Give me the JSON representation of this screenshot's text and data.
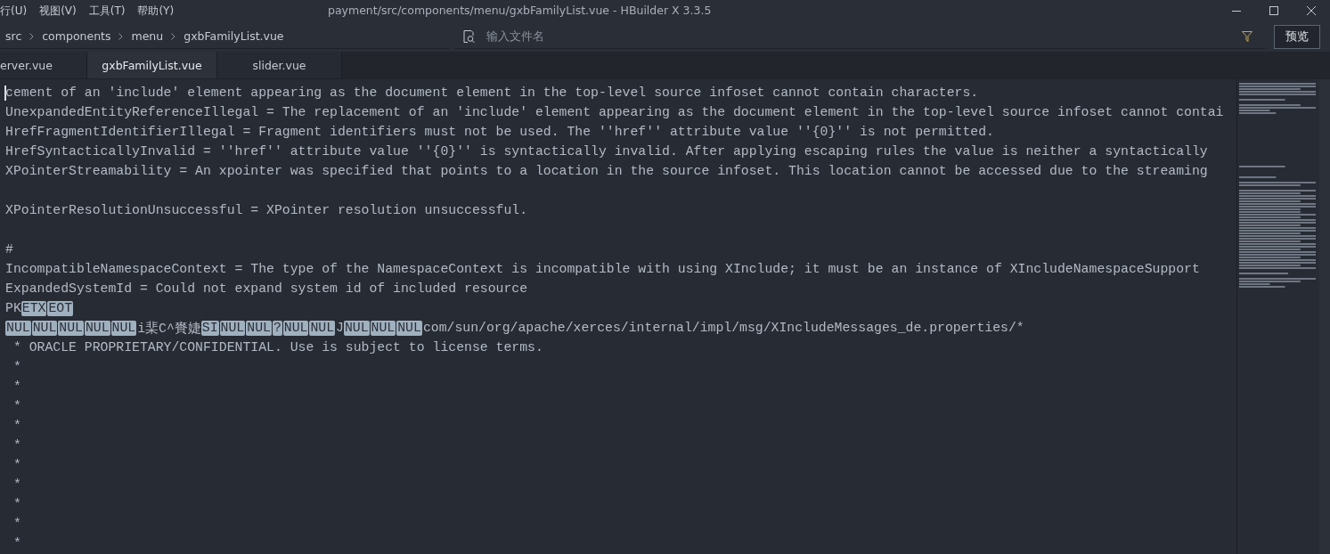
{
  "menu": [
    "行(U)",
    "视图(V)",
    "工具(T)",
    "帮助(Y)"
  ],
  "window": {
    "title": "payment/src/components/menu/gxbFamilyList.vue - HBuilder X 3.3.5"
  },
  "breadcrumb": [
    "src",
    "components",
    "menu",
    "gxbFamilyList.vue"
  ],
  "search": {
    "placeholder": "输入文件名"
  },
  "preview_button": "预览",
  "tabs": [
    {
      "label": "erver.vue",
      "selected": false
    },
    {
      "label": "gxbFamilyList.vue",
      "selected": true
    },
    {
      "label": "slider.vue",
      "selected": false
    }
  ],
  "lines": [
    {
      "kind": "code",
      "cursor": true,
      "segments": [
        {
          "kind": "text",
          "text": "cement of an 'include' element appearing as the document element in the top-level source infoset cannot contain characters."
        }
      ]
    },
    {
      "kind": "code",
      "segments": [
        {
          "kind": "text",
          "text": "UnexpandedEntityReferenceIllegal = The replacement of an 'include' element appearing as the document element in the top-level source infoset cannot contai"
        }
      ]
    },
    {
      "kind": "code",
      "segments": [
        {
          "kind": "text",
          "text": "HrefFragmentIdentifierIllegal = Fragment identifiers must not be used. The ''href'' attribute value ''{0}'' is not permitted."
        }
      ]
    },
    {
      "kind": "code",
      "segments": [
        {
          "kind": "text",
          "text": "HrefSyntacticallyInvalid = ''href'' attribute value ''{0}'' is syntactically invalid. After applying escaping rules the value is neither a syntactically"
        }
      ]
    },
    {
      "kind": "code",
      "segments": [
        {
          "kind": "text",
          "text": "XPointerStreamability = An xpointer was specified that points to a location in the source infoset. This location cannot be accessed due to the streaming"
        }
      ]
    },
    {
      "kind": "blank"
    },
    {
      "kind": "code",
      "segments": [
        {
          "kind": "text",
          "text": "XPointerResolutionUnsuccessful = XPointer resolution unsuccessful."
        }
      ]
    },
    {
      "kind": "blank"
    },
    {
      "kind": "code",
      "segments": [
        {
          "kind": "text",
          "text": "#"
        }
      ]
    },
    {
      "kind": "code",
      "segments": [
        {
          "kind": "text",
          "text": "IncompatibleNamespaceContext = The type of the NamespaceContext is incompatible with using XInclude; it must be an instance of XIncludeNamespaceSupport"
        }
      ]
    },
    {
      "kind": "code",
      "segments": [
        {
          "kind": "text",
          "text": "ExpandedSystemId = Could not expand system id of included resource"
        }
      ]
    },
    {
      "kind": "code",
      "segments": [
        {
          "kind": "text",
          "text": "PK"
        },
        {
          "kind": "control",
          "text": "ETX"
        },
        {
          "kind": "control",
          "text": "EOT"
        }
      ]
    },
    {
      "kind": "code",
      "segments": [
        {
          "kind": "control",
          "text": "NUL"
        },
        {
          "kind": "control",
          "text": "NUL"
        },
        {
          "kind": "control",
          "text": "NUL"
        },
        {
          "kind": "control",
          "text": "NUL"
        },
        {
          "kind": "control",
          "text": "NUL"
        },
        {
          "kind": "text",
          "text": "i棐C^賚婕"
        },
        {
          "kind": "control",
          "text": "SI"
        },
        {
          "kind": "control",
          "text": "NUL"
        },
        {
          "kind": "control",
          "text": "NUL"
        },
        {
          "kind": "control",
          "text": "?"
        },
        {
          "kind": "control",
          "text": "NUL"
        },
        {
          "kind": "control",
          "text": "NUL"
        },
        {
          "kind": "text",
          "text": "J"
        },
        {
          "kind": "control",
          "text": "NUL"
        },
        {
          "kind": "control",
          "text": "NUL"
        },
        {
          "kind": "control",
          "text": "NUL"
        },
        {
          "kind": "text",
          "text": "com/sun/org/apache/xerces/internal/impl/msg/XIncludeMessages_de.properties/*"
        }
      ]
    },
    {
      "kind": "code",
      "segments": [
        {
          "kind": "text",
          "text": " * ORACLE PROPRIETARY/CONFIDENTIAL. Use is subject to license terms."
        }
      ]
    },
    {
      "kind": "code",
      "segments": [
        {
          "kind": "text",
          "text": " *"
        }
      ]
    },
    {
      "kind": "code",
      "segments": [
        {
          "kind": "text",
          "text": " *"
        }
      ]
    },
    {
      "kind": "code",
      "segments": [
        {
          "kind": "text",
          "text": " *"
        }
      ]
    },
    {
      "kind": "code",
      "segments": [
        {
          "kind": "text",
          "text": " *"
        }
      ]
    },
    {
      "kind": "code",
      "segments": [
        {
          "kind": "text",
          "text": " *"
        }
      ]
    },
    {
      "kind": "code",
      "segments": [
        {
          "kind": "text",
          "text": " *"
        }
      ]
    },
    {
      "kind": "code",
      "segments": [
        {
          "kind": "text",
          "text": " *"
        }
      ]
    },
    {
      "kind": "code",
      "segments": [
        {
          "kind": "text",
          "text": " *"
        }
      ]
    },
    {
      "kind": "code",
      "segments": [
        {
          "kind": "text",
          "text": " *"
        }
      ]
    },
    {
      "kind": "code",
      "segments": [
        {
          "kind": "text",
          "text": " *"
        }
      ]
    }
  ]
}
